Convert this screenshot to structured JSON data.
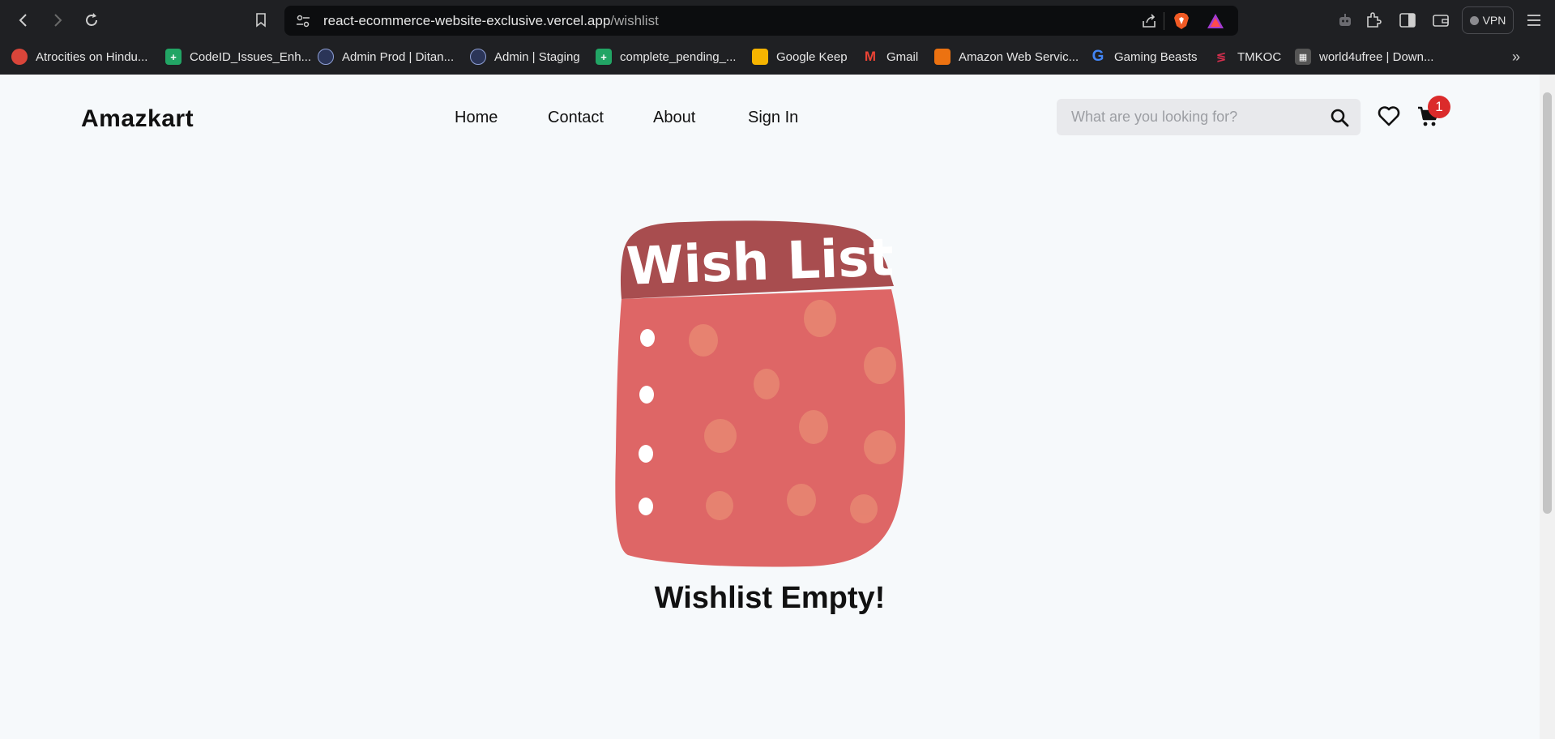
{
  "browser": {
    "url_host": "react-ecommerce-website-exclusive.vercel.app",
    "url_path": "/wishlist",
    "vpn_label": "VPN",
    "bookmarks": [
      {
        "label": "Atrocities on Hindu...",
        "icon": "red-circle-icon",
        "color": "#d9453a"
      },
      {
        "label": "CodeID_Issues_Enh...",
        "icon": "sheets-icon",
        "color": "#22a565"
      },
      {
        "label": "Admin Prod | Ditan...",
        "icon": "globe-icon",
        "color": "#3a4a7a"
      },
      {
        "label": "Admin | Staging",
        "icon": "globe-icon",
        "color": "#3a4a7a"
      },
      {
        "label": "complete_pending_...",
        "icon": "sheets-icon",
        "color": "#22a565"
      },
      {
        "label": "Google Keep",
        "icon": "keep-icon",
        "color": "#f6b400"
      },
      {
        "label": "Gmail",
        "icon": "gmail-icon",
        "color": "#ea4335"
      },
      {
        "label": "Amazon Web Servic...",
        "icon": "aws-icon",
        "color": "#ec7211"
      },
      {
        "label": "Gaming Beasts",
        "icon": "g-icon",
        "color": "#4285f4"
      },
      {
        "label": "TMKOC",
        "icon": "tmkoc-icon",
        "color": "#d62e4e"
      },
      {
        "label": "world4ufree | Down...",
        "icon": "film-icon",
        "color": "#9a9a9a"
      }
    ]
  },
  "header": {
    "logo": "Amazkart",
    "nav": [
      "Home",
      "Contact",
      "About",
      "Sign In"
    ],
    "search_placeholder": "What are you looking for?",
    "cart_count": "1"
  },
  "main": {
    "illustration_text": "Wish List",
    "empty_message": "Wishlist Empty!"
  },
  "colors": {
    "accent": "#db2b2b",
    "notepad_header": "#a84d4f",
    "notepad_body": "#de6666",
    "notepad_spots": "#e88a73"
  }
}
